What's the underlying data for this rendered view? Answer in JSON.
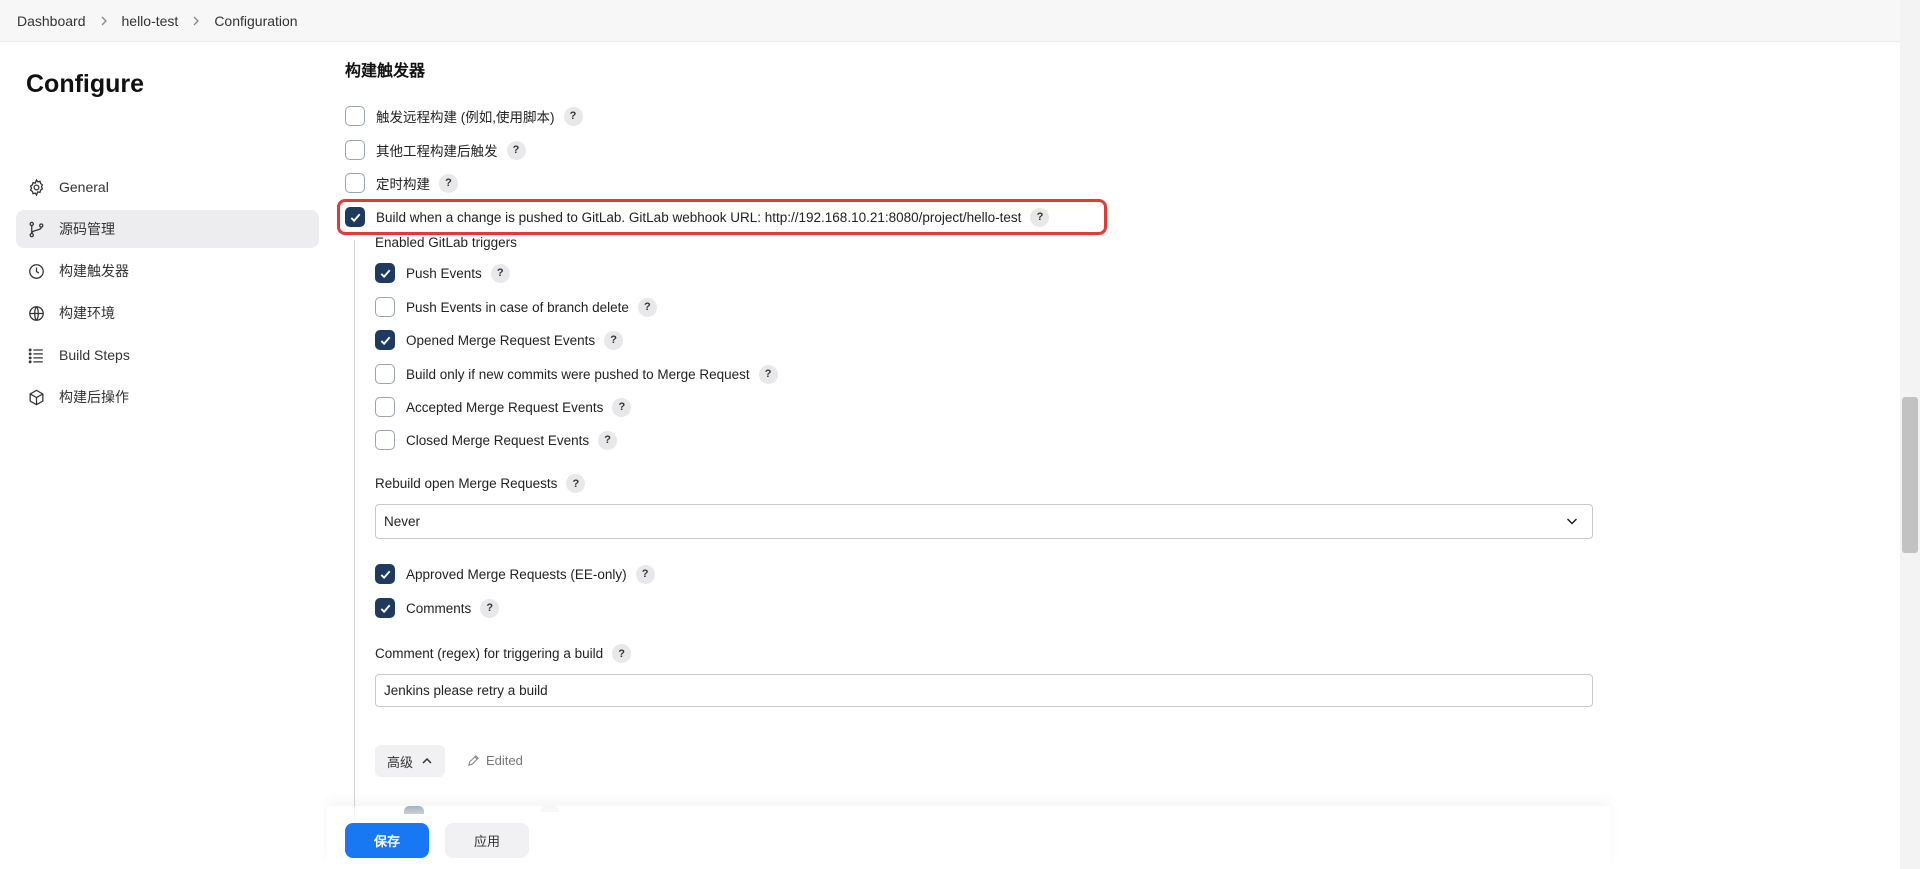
{
  "breadcrumb": {
    "items": [
      "Dashboard",
      "hello-test",
      "Configuration"
    ]
  },
  "sidebar": {
    "title": "Configure",
    "items": [
      {
        "label": "General",
        "icon": "gear-icon",
        "active": false
      },
      {
        "label": "源码管理",
        "icon": "branch-icon",
        "active": true
      },
      {
        "label": "构建触发器",
        "icon": "clock-icon",
        "active": false
      },
      {
        "label": "构建环境",
        "icon": "globe-icon",
        "active": false
      },
      {
        "label": "Build Steps",
        "icon": "list-icon",
        "active": false
      },
      {
        "label": "构建后操作",
        "icon": "cube-icon",
        "active": false
      }
    ]
  },
  "main": {
    "section_title": "构建触发器",
    "triggers": [
      {
        "label": "触发远程构建 (例如,使用脚本)",
        "checked": false
      },
      {
        "label": "其他工程构建后触发",
        "checked": false
      },
      {
        "label": "定时构建",
        "checked": false
      },
      {
        "label": "Build when a change is pushed to GitLab. GitLab webhook URL: http://192.168.10.21:8080/project/hello-test",
        "checked": true
      }
    ],
    "gitlab_triggers_label": "Enabled GitLab triggers",
    "gitlab_triggers": [
      {
        "label": "Push Events",
        "checked": true
      },
      {
        "label": "Push Events in case of branch delete",
        "checked": false
      },
      {
        "label": "Opened Merge Request Events",
        "checked": true
      },
      {
        "label": "Build only if new commits were pushed to Merge Request",
        "checked": false
      },
      {
        "label": "Accepted Merge Request Events",
        "checked": false
      },
      {
        "label": "Closed Merge Request Events",
        "checked": false
      }
    ],
    "rebuild_label": "Rebuild open Merge Requests",
    "rebuild_value": "Never",
    "extra_options": [
      {
        "label": "Approved Merge Requests (EE-only)",
        "checked": true
      },
      {
        "label": "Comments",
        "checked": true
      }
    ],
    "comment_regex_label": "Comment (regex) for triggering a build",
    "comment_regex_value": "Jenkins please retry a build",
    "advanced_label": "高级",
    "edited_label": "Edited",
    "help_glyph": "?"
  },
  "footer": {
    "save_label": "保存",
    "apply_label": "应用"
  },
  "colors": {
    "checked_fill": "#1f3a5f",
    "highlight_border": "#e53935",
    "save_button": "#1877f2"
  }
}
